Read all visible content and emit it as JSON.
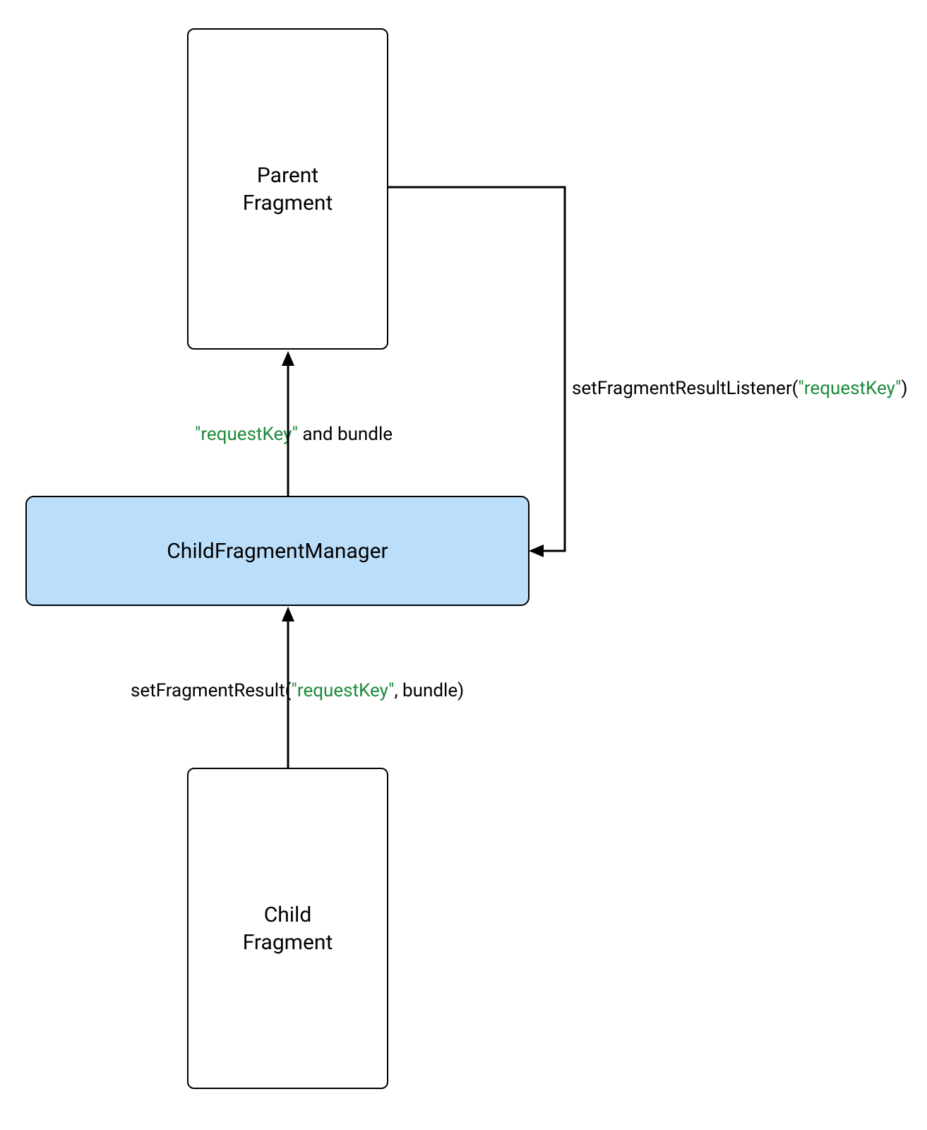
{
  "nodes": {
    "parent": {
      "line1": "Parent",
      "line2": "Fragment"
    },
    "manager": {
      "label": "ChildFragmentManager"
    },
    "child": {
      "line1": "Child",
      "line2": "Fragment"
    }
  },
  "edges": {
    "listener": {
      "prefix": "setFragmentResultListener(",
      "key": "\"requestKey\"",
      "suffix": ")"
    },
    "toParent": {
      "key": "\"requestKey\"",
      "text": " and bundle"
    },
    "fromChild": {
      "prefix": "setFragmentResult(",
      "key": "\"requestKey\"",
      "suffix": ", bundle)"
    }
  }
}
